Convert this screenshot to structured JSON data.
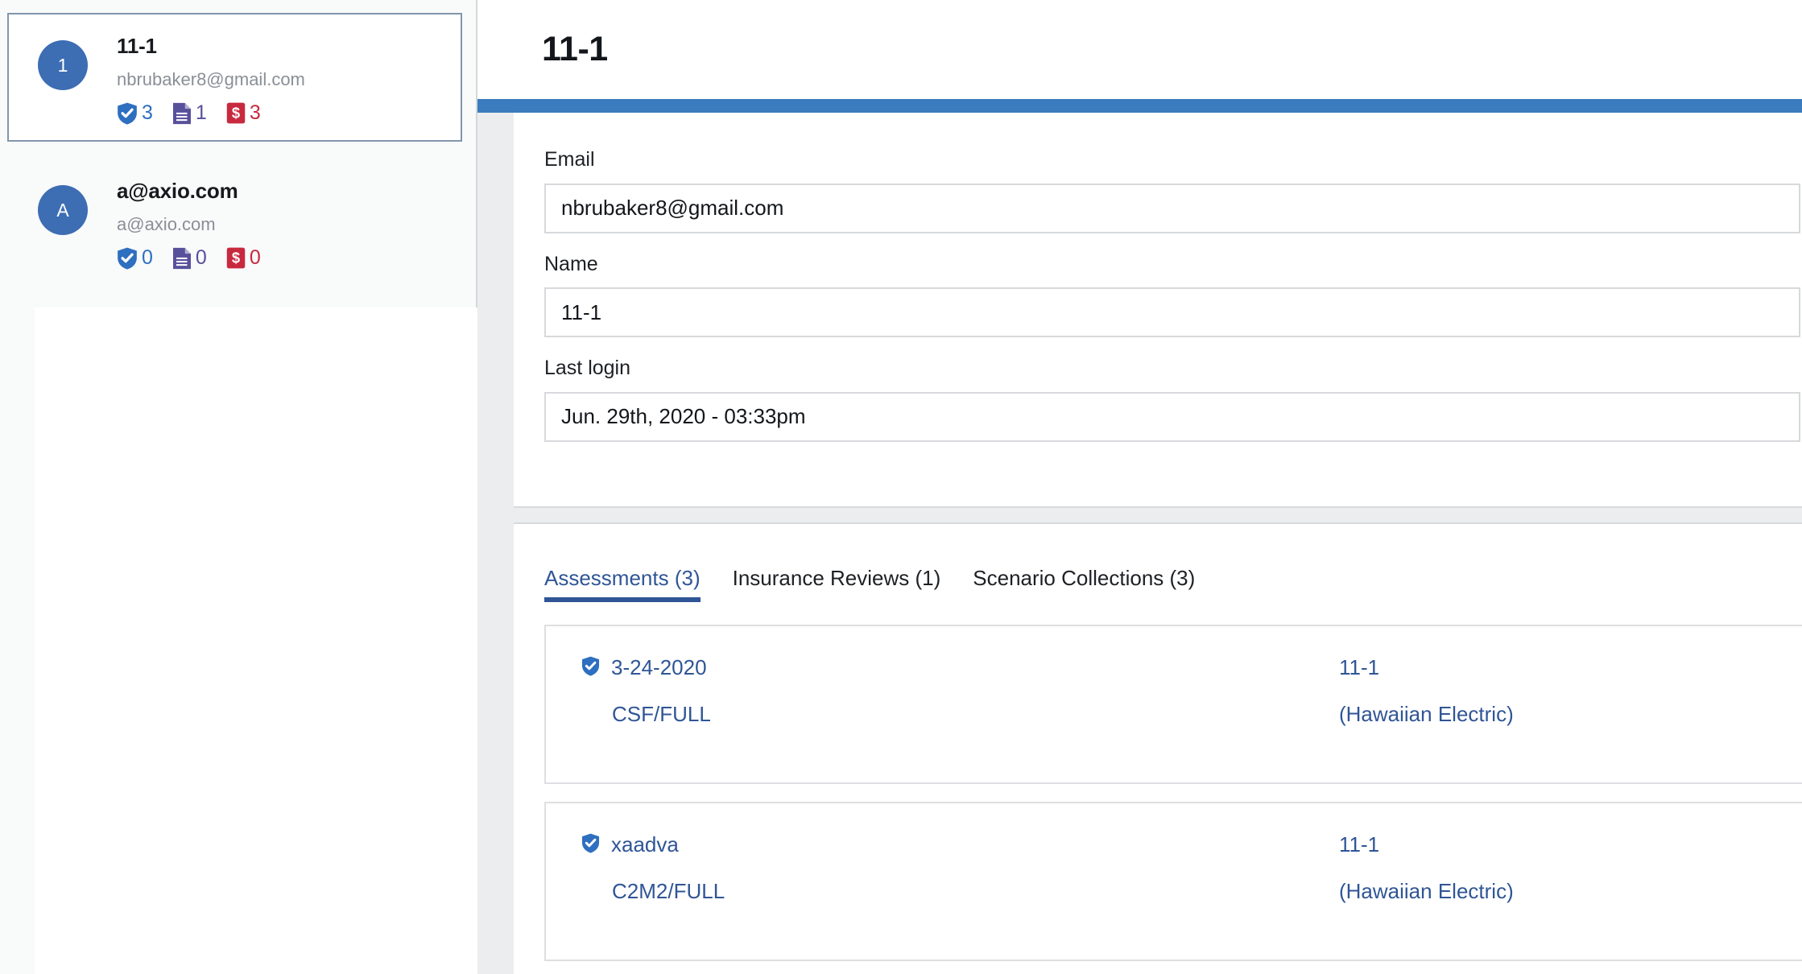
{
  "sidebar": {
    "users": [
      {
        "avatar_initial": "1",
        "name": "11-1",
        "email": "nbrubaker8@gmail.com",
        "stats": {
          "assessments": "3",
          "insurance_reviews": "1",
          "scenario_collections": "3"
        },
        "selected": true
      },
      {
        "avatar_initial": "A",
        "name": "a@axio.com",
        "email": "a@axio.com",
        "stats": {
          "assessments": "0",
          "insurance_reviews": "0",
          "scenario_collections": "0"
        },
        "selected": false
      }
    ]
  },
  "header": {
    "title": "11-1"
  },
  "form": {
    "fields": [
      {
        "label": "Email",
        "value": "nbrubaker8@gmail.com",
        "placeholder": "Email"
      },
      {
        "label": "Name",
        "value": "11-1",
        "placeholder": "Name"
      },
      {
        "label": "Last login",
        "value": "Jun. 29th, 2020 - 03:33pm",
        "placeholder": "Last login"
      }
    ]
  },
  "tabs": [
    {
      "label": "Assessments (3)",
      "active": true
    },
    {
      "label": "Insurance Reviews (1)",
      "active": false
    },
    {
      "label": "Scenario Collections (3)",
      "active": false
    }
  ],
  "assessments": [
    {
      "icon": "shield-check-icon",
      "title": "3-24-2020",
      "subtitle": "CSF/FULL",
      "org": "11-1",
      "org_sub": "(Hawaiian Electric)"
    },
    {
      "icon": "shield-check-icon",
      "title": "xaadva",
      "subtitle": "C2M2/FULL",
      "org": "11-1",
      "org_sub": "(Hawaiian Electric)"
    }
  ],
  "colors": {
    "accent_blue": "#3a7cbd",
    "link_blue": "#2f5596",
    "avatar_blue": "#3d6db3",
    "shield_blue": "#2e6fc0",
    "doc_purple": "#57509b",
    "dollar_red": "#c8293f",
    "gutter_gray": "#ebedef",
    "border_gray": "#d7d9dc"
  }
}
